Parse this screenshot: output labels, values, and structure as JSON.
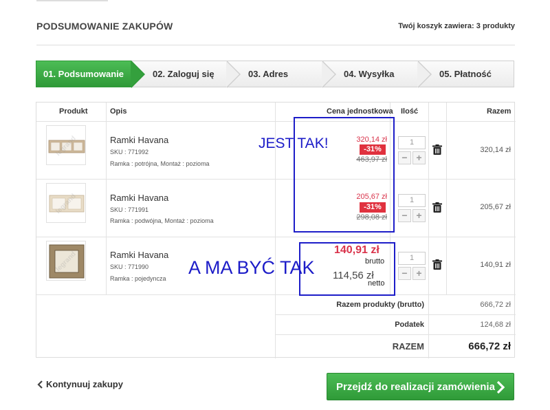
{
  "header": {
    "title": "PODSUMOWANIE ZAKUPÓW",
    "cart_count": "Twój koszyk zawiera: 3 produkty"
  },
  "steps": [
    {
      "label": "01. Podsumowanie",
      "active": true
    },
    {
      "label": "02. Zaloguj się",
      "active": false
    },
    {
      "label": "03. Adres",
      "active": false
    },
    {
      "label": "04. Wysyłka",
      "active": false
    },
    {
      "label": "05. Płatność",
      "active": false
    }
  ],
  "table": {
    "headers": {
      "product": "Produkt",
      "description": "Opis",
      "unit_price": "Cena jednostkowa",
      "quantity": "Ilość",
      "total": "Razem"
    },
    "rows": [
      {
        "name": "Ramki Havana",
        "sku": "SKU : 771992",
        "attributes": "Ramka : potrójna, Montaż : pozioma",
        "price": "320,14 zł",
        "discount": "-31%",
        "old_price": "463,97 zł",
        "qty": "1",
        "total": "320,14 zł",
        "thumb_watermark": "legrand"
      },
      {
        "name": "Ramki Havana",
        "sku": "SKU : 771991",
        "attributes": "Ramka : podwójna, Montaż : pozioma",
        "price": "205,67 zł",
        "discount": "-31%",
        "old_price": "298,08 zł",
        "qty": "1",
        "total": "205,67 zł",
        "thumb_watermark": "legrand"
      },
      {
        "name": "Ramki Havana",
        "sku": "SKU : 771990",
        "attributes": "Ramka : pojedyncza",
        "price_brutto": "140,91 zł",
        "brutto_label": "brutto",
        "price_netto": "114,56 zł",
        "netto_label": "netto",
        "qty": "1",
        "total": "140,91 zł",
        "thumb_watermark": "legrand"
      }
    ],
    "summary": {
      "products_label": "Razem produkty (brutto)",
      "products_value": "666,72 zł",
      "tax_label": "Podatek",
      "tax_value": "124,68 zł",
      "grand_label": "RAZEM",
      "grand_value": "666,72 zł"
    }
  },
  "annotations": {
    "top": "JEST TAK!",
    "bottom": "A MA BYĆ TAK",
    "color": "#1c1cc8"
  },
  "footer": {
    "continue": "Kontynuuj zakupy",
    "checkout": "Przejdź do realizacji zamówienia"
  },
  "colors": {
    "accent_green": "#3aa843",
    "price_red": "#d9324a",
    "badge_red": "#e0313e"
  }
}
